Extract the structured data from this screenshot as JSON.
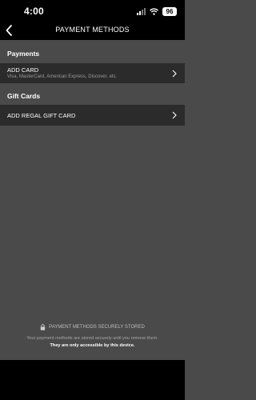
{
  "status_bar": {
    "time": "4:00",
    "battery": "96"
  },
  "nav": {
    "title": "PAYMENT METHODS"
  },
  "sections": {
    "payments": {
      "header": "Payments",
      "add_card_title": "ADD CARD",
      "add_card_subtitle": "Visa, MasterCard, American Express, Discover, etc."
    },
    "gift_cards": {
      "header": "Gift Cards",
      "add_gift_card_title": "ADD REGAL GIFT CARD"
    }
  },
  "footer": {
    "secure_label": "PAYMENT METHODS SECURELY STORED",
    "secure_note": "Your payment methods are stored securely until you remove them.",
    "secure_note_bold": "They are only accessible by this device."
  }
}
